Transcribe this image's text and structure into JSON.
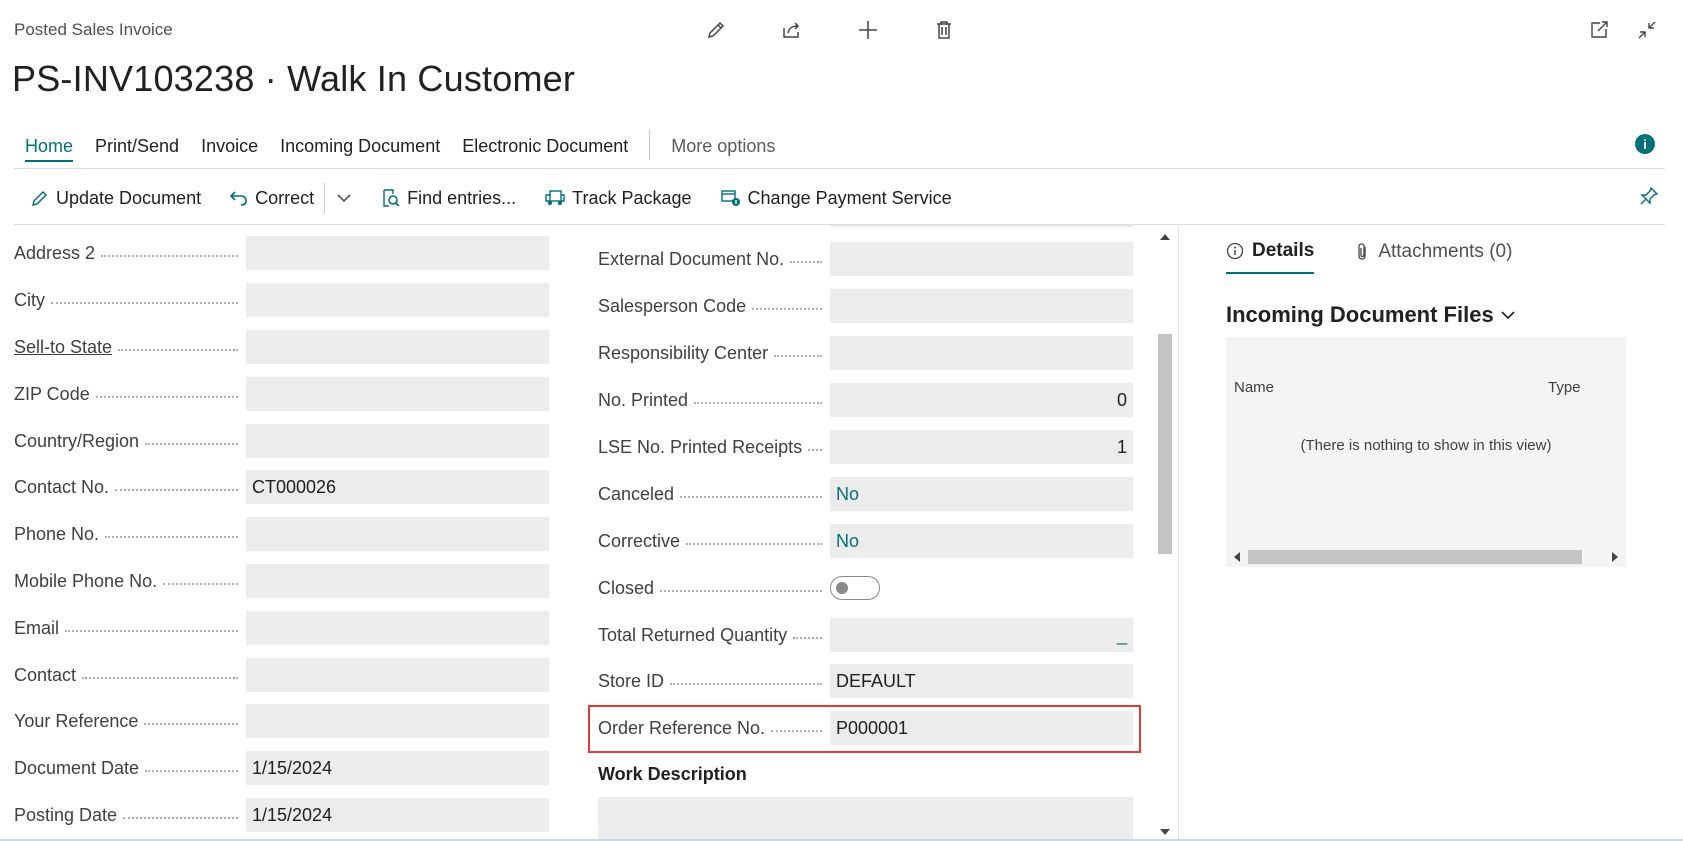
{
  "header": {
    "caption": "Posted Sales Invoice",
    "title": "PS-INV103238 · Walk In Customer"
  },
  "tabs": [
    {
      "label": "Home",
      "active": true
    },
    {
      "label": "Print/Send"
    },
    {
      "label": "Invoice"
    },
    {
      "label": "Incoming Document"
    },
    {
      "label": "Electronic Document"
    },
    {
      "label": "More options"
    }
  ],
  "actions": {
    "update_document": "Update Document",
    "correct": "Correct",
    "find_entries": "Find entries...",
    "track_package": "Track Package",
    "change_payment_service": "Change Payment Service"
  },
  "left_fields": [
    {
      "label": "Address 2",
      "value": ""
    },
    {
      "label": "City",
      "value": ""
    },
    {
      "label": "Sell-to State",
      "value": "",
      "link": true
    },
    {
      "label": "ZIP Code",
      "value": ""
    },
    {
      "label": "Country/Region",
      "value": ""
    },
    {
      "label": "Contact No.",
      "value": "CT000026"
    },
    {
      "label": "Phone No.",
      "value": ""
    },
    {
      "label": "Mobile Phone No.",
      "value": ""
    },
    {
      "label": "Email",
      "value": ""
    },
    {
      "label": "Contact",
      "value": ""
    },
    {
      "label": "Your Reference",
      "value": ""
    },
    {
      "label": "Document Date",
      "value": "1/15/2024"
    },
    {
      "label": "Posting Date",
      "value": "1/15/2024"
    }
  ],
  "mid_fields": [
    {
      "label": "External Document No.",
      "value": ""
    },
    {
      "label": "Salesperson Code",
      "value": ""
    },
    {
      "label": "Responsibility Center",
      "value": ""
    },
    {
      "label": "No. Printed",
      "value": "0"
    },
    {
      "label": "LSE No. Printed Receipts",
      "value": "1"
    },
    {
      "label": "Canceled",
      "value": "No"
    },
    {
      "label": "Corrective",
      "value": "No"
    },
    {
      "label": "Closed",
      "value": "off"
    },
    {
      "label": "Total Returned Quantity",
      "value": "_"
    },
    {
      "label": "Store ID",
      "value": "DEFAULT"
    },
    {
      "label": "Order Reference No.",
      "value": "P000001"
    }
  ],
  "work_description": {
    "heading": "Work Description",
    "value": ""
  },
  "factbox": {
    "tabs": {
      "details": "Details",
      "attachments": "Attachments (0)"
    },
    "title": "Incoming Document Files",
    "columns": {
      "name": "Name",
      "type": "Type"
    },
    "empty_text": "(There is nothing to show in this view)"
  },
  "colors": {
    "accent": "#00707a",
    "highlight": "#e03a3a",
    "field_bg": "#ececec"
  }
}
